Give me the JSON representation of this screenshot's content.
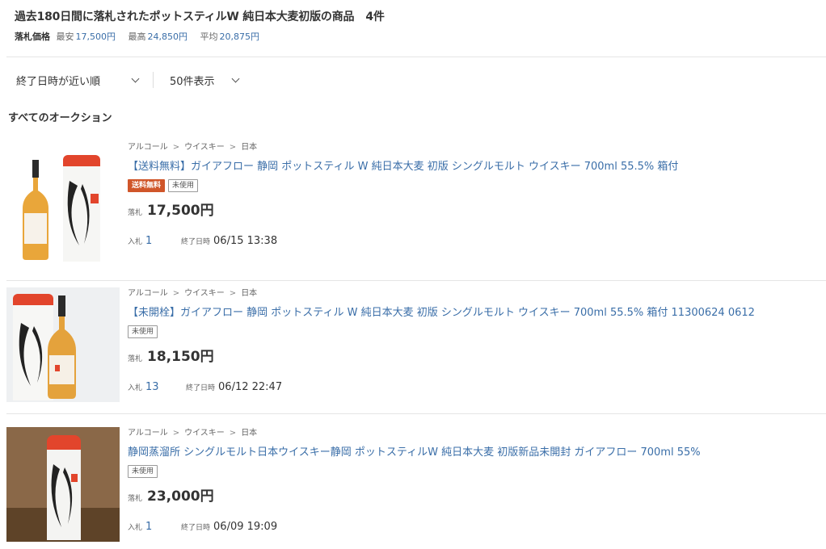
{
  "header": {
    "title": "過去180日間に落札されたポットスティルW 純日本大麦初版の商品",
    "count": "4件",
    "price_label": "落札価格",
    "min_label": "最安",
    "min_value": "17,500円",
    "max_label": "最高",
    "max_value": "24,850円",
    "avg_label": "平均",
    "avg_value": "20,875円"
  },
  "sort": {
    "order": "終了日時が近い順",
    "per_page": "50件表示"
  },
  "section_title": "すべてのオークション",
  "breadcrumb_sep": ">",
  "labels": {
    "price": "落札",
    "bids": "入札",
    "end": "終了日時"
  },
  "items": [
    {
      "breadcrumb": [
        "アルコール",
        "ウイスキー",
        "日本"
      ],
      "title": "【送料無料】ガイアフロー 静岡 ポットスティル W 純日本大麦 初版 シングルモルト ウイスキー 700ml 55.5% 箱付",
      "tags": [
        "送料無料",
        "未使用"
      ],
      "price": "17,500円",
      "bids": "1",
      "end": "06/15 13:38"
    },
    {
      "breadcrumb": [
        "アルコール",
        "ウイスキー",
        "日本"
      ],
      "title": "【未開栓】ガイアフロー 静岡 ポットスティル W 純日本大麦 初版 シングルモルト ウイスキー 700ml 55.5% 箱付 11300624 0612",
      "tags": [
        "未使用"
      ],
      "price": "18,150円",
      "bids": "13",
      "end": "06/12 22:47"
    },
    {
      "breadcrumb": [
        "アルコール",
        "ウイスキー",
        "日本"
      ],
      "title": "静岡蒸溜所 シングルモルト日本ウイスキー静岡 ポットスティルW 純日本大麦 初版新品未開封 ガイアフロー 700ml 55%",
      "tags": [
        "未使用"
      ],
      "price": "23,000円",
      "bids": "1",
      "end": "06/09 19:09"
    }
  ],
  "colors": {
    "link": "#3a6ea8",
    "shipping_tag": "#d0562a",
    "tube_red": "#e2452c"
  }
}
